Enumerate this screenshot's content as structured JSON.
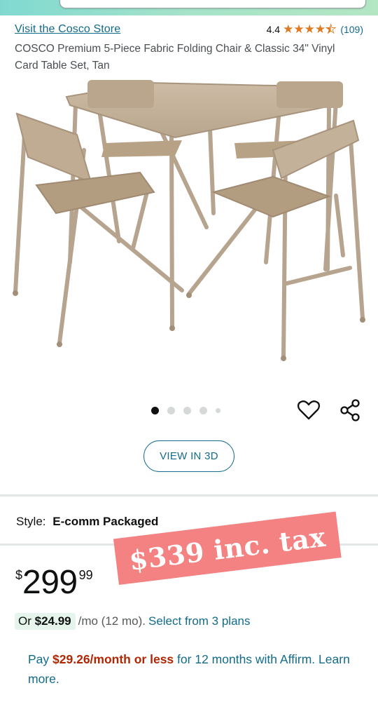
{
  "header": {
    "store_link": "Visit the Cosco Store",
    "rating_value": "4.4",
    "rating_count": "(109)",
    "title": "COSCO Premium 5-Piece Fabric Folding Chair & Classic 34\" Vinyl Card Table Set, Tan"
  },
  "gallery": {
    "image_alt": "folding table and four chairs",
    "dot_count": 5,
    "active_dot": 0,
    "view_3d_label": "VIEW IN 3D"
  },
  "style": {
    "label": "Style:",
    "value": "E-comm Packaged"
  },
  "price": {
    "symbol": "$",
    "whole": "299",
    "fraction": "99",
    "overlay_note": "$339 inc. tax"
  },
  "financing": {
    "or": "Or",
    "monthly_amount": "$24.99",
    "term_text": "/mo (12 mo).",
    "plans_link": "Select from 3 plans"
  },
  "affirm": {
    "pay": "Pay",
    "amount": "$29.26/month or less",
    "rest": "for 12 months with Affirm.",
    "learn_more": "Learn more."
  },
  "colors": {
    "link": "#136b8a",
    "star": "#de7921",
    "affirm_amount": "#b12704",
    "banner": "#f47c7c"
  }
}
